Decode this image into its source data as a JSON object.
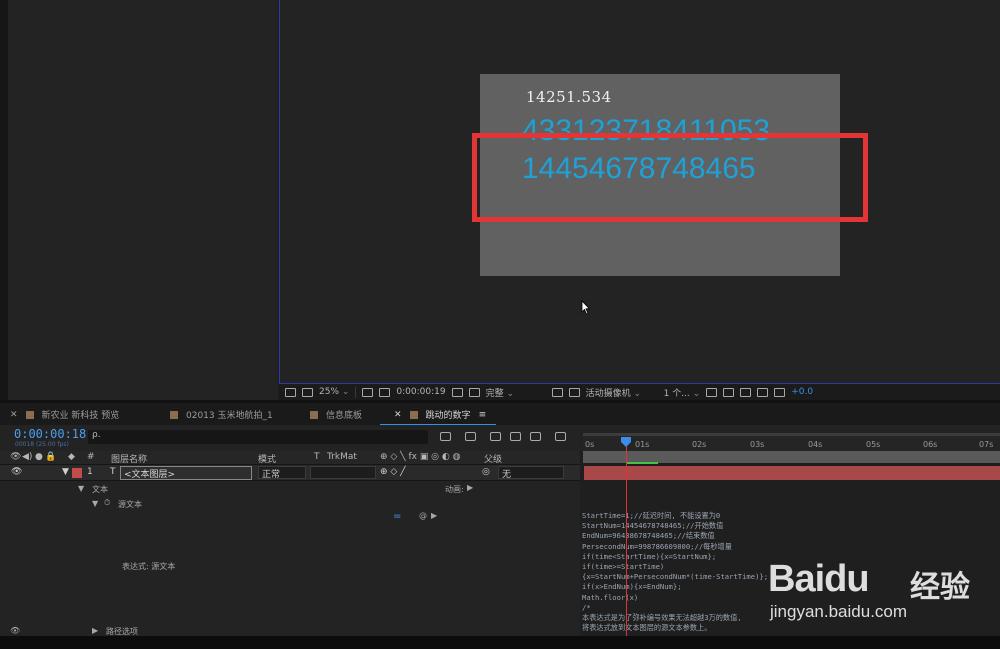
{
  "viewer": {
    "canvas_text_small": "14251.534",
    "canvas_text_large_1": "433123718411053",
    "canvas_text_large_2": "14454678748465",
    "highlight_color": "#e33535",
    "text_color": "#1ea2d6"
  },
  "viewer_toolbar": {
    "zoom": "25%",
    "timecode": "0:00:00:19",
    "resolution": "完整",
    "camera": "活动摄像机",
    "views": "1 个...",
    "exposure": "+0.0"
  },
  "tabs": [
    {
      "label": "新农业 新科技 预览"
    },
    {
      "label": "02013 玉米地航拍_1"
    },
    {
      "label": "信息底板"
    },
    {
      "label": "跳动的数字"
    }
  ],
  "timeline": {
    "current_time": "0:00:00:18",
    "fps": "00018 (25.00 fps)",
    "search_placeholder": "ρ.",
    "columns": {
      "num": "#",
      "layer_name": "图层名称",
      "mode": "模式",
      "t": "T",
      "trkmat": "TrkMat",
      "parent": "父级"
    },
    "layer": {
      "index": "1",
      "type_icon": "T",
      "name": "<文本图层>",
      "mode": "正常",
      "parent": "无"
    },
    "props": {
      "text_group": "文本",
      "animate": "动画:",
      "source_text": "源文本",
      "expression_label": "表达式: 源文本",
      "path_options": "路径选项"
    },
    "ruler_ticks": [
      "0s",
      "01s",
      "02s",
      "03s",
      "04s",
      "05s",
      "06s",
      "07s"
    ],
    "code_lines": [
      "StartTime=1;//延迟时间, 不能设置为0",
      "StartNum=14454678748465;//开始数值",
      "EndNum=96438678748465;//结束数值",
      "PersecondNum=998786609800;//每秒增量",
      "if(time<StartTime){x=StartNum};",
      "if(time>=StartTime)",
      "{x=StartNum+PersecondNum*(time-StartTime)};",
      "if(x>EndNum){x=EndNum};",
      "Math.floor(x)",
      "/*",
      "本表达式是为了弥补编号效果无法超越3万的数值,",
      "将表达式放到文本图层的源文本参数上。"
    ]
  },
  "watermark": {
    "logo": "Baidu",
    "cn": "经验",
    "url": "jingyan.baidu.com"
  }
}
